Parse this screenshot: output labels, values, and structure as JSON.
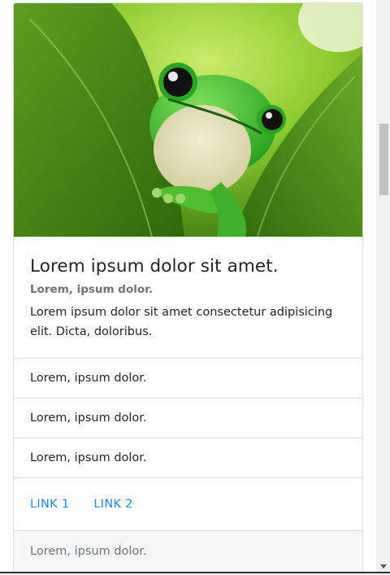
{
  "card": {
    "image_alt": "green tree frog peeking between leaves",
    "title": "Lorem ipsum dolor sit amet.",
    "subtitle": "Lorem, ipsum dolor.",
    "text": "Lorem ipsum dolor sit amet consectetur adipisicing elit. Dicta, doloribus.",
    "list_items": [
      "Lorem, ipsum dolor.",
      "Lorem, ipsum dolor.",
      "Lorem, ipsum dolor."
    ],
    "links": [
      "LINK 1",
      "LINK 2"
    ],
    "footer": "Lorem, ipsum dolor."
  },
  "colors": {
    "link": "#1a8cff",
    "muted": "#6c757d",
    "text": "#212529",
    "border": "#dfdfdf",
    "footer_bg": "#f7f7f7"
  },
  "icons": [
    "scroll-down-arrow-icon"
  ]
}
